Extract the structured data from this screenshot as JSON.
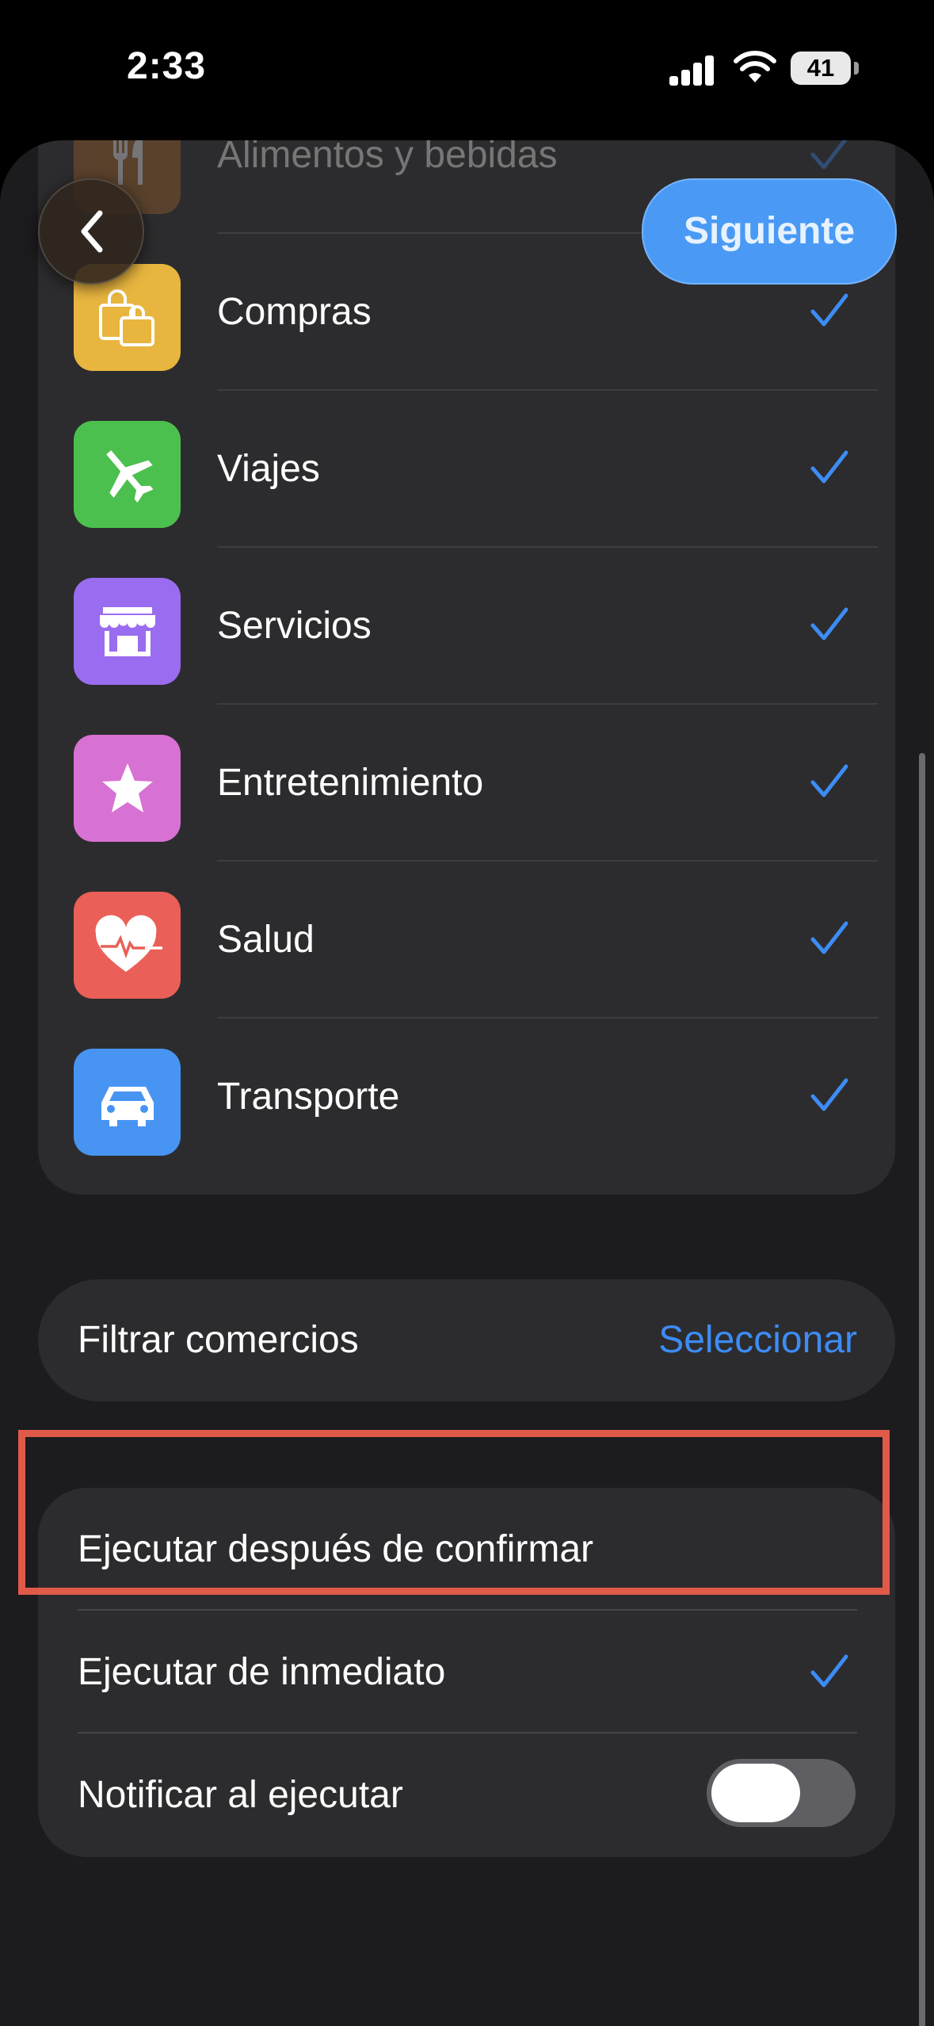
{
  "status_bar": {
    "time": "2:33",
    "battery": "41"
  },
  "nav": {
    "next_label": "Siguiente"
  },
  "categories": [
    {
      "label": "Alimentos y bebidas",
      "icon": "fork-knife-icon",
      "color": "#b06a2a",
      "checked": true
    },
    {
      "label": "Compras",
      "icon": "shopping-bags-icon",
      "color": "#e8b53f",
      "checked": true
    },
    {
      "label": "Viajes",
      "icon": "airplane-icon",
      "color": "#4cc04e",
      "checked": true
    },
    {
      "label": "Servicios",
      "icon": "storefront-icon",
      "color": "#9a6cf0",
      "checked": true
    },
    {
      "label": "Entretenimiento",
      "icon": "star-icon",
      "color": "#d871d4",
      "checked": true
    },
    {
      "label": "Salud",
      "icon": "heart-pulse-icon",
      "color": "#ea5f57",
      "checked": true
    },
    {
      "label": "Transporte",
      "icon": "car-icon",
      "color": "#4894f2",
      "checked": true
    }
  ],
  "filter": {
    "label": "Filtrar comercios",
    "action": "Seleccionar"
  },
  "execution": {
    "options": [
      {
        "label": "Ejecutar después de confirmar",
        "checked": false
      },
      {
        "label": "Ejecutar de inmediato",
        "checked": true
      }
    ],
    "notify": {
      "label": "Notificar al ejecutar",
      "on": false
    }
  },
  "accent_color": "#3d8cf5",
  "highlight_color": "#e05a49"
}
